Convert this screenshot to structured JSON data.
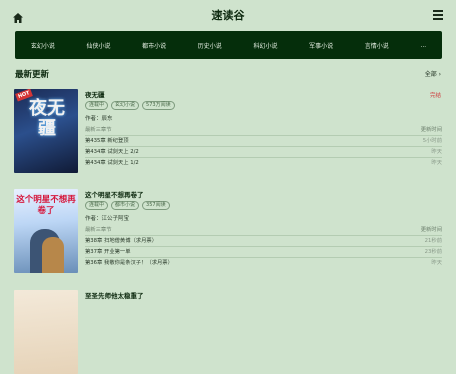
{
  "header": {
    "title": "速读谷",
    "home_icon": "home-icon",
    "menu_icon": "menu-icon"
  },
  "nav": {
    "items": [
      "玄幻小说",
      "仙侠小说",
      "都市小说",
      "历史小说",
      "科幻小说",
      "军事小说",
      "言情小说",
      "..."
    ]
  },
  "section": {
    "title": "最新更新",
    "more_label": "全部 ›"
  },
  "books": [
    {
      "name": "夜无疆",
      "status": "完结",
      "tags": [
        "连载中",
        "玄幻小说",
        "573万阅读"
      ],
      "author": "作者：辰东",
      "chapters_header": "最新三章节",
      "time_header": "更新时间",
      "chapters": [
        {
          "title": "第435章 新纪登顶",
          "time": "5小时前"
        },
        {
          "title": "第434章 试剑天上 2/2",
          "time": "昨天"
        },
        {
          "title": "第434章 试剑天上 1/2",
          "time": "昨天"
        }
      ],
      "cover_text": "夜无疆",
      "cover_badge": "HOT"
    },
    {
      "name": "这个明星不想再卷了",
      "status": "",
      "tags": [
        "连载中",
        "都市小说",
        "357阅读"
      ],
      "author": "作者：江公子阿宝",
      "chapters_header": "最新三章节",
      "time_header": "更新时间",
      "chapters": [
        {
          "title": "第38章 扫地僧黄博（求月票）",
          "time": "21秒前"
        },
        {
          "title": "第37章 开业第一单",
          "time": "23秒前"
        },
        {
          "title": "第36章 我敬你是条汉子！（求月票）",
          "time": "昨天"
        }
      ],
      "cover_text": "这个明星不想再卷了"
    },
    {
      "name": "至圣先师他太稳重了"
    }
  ]
}
